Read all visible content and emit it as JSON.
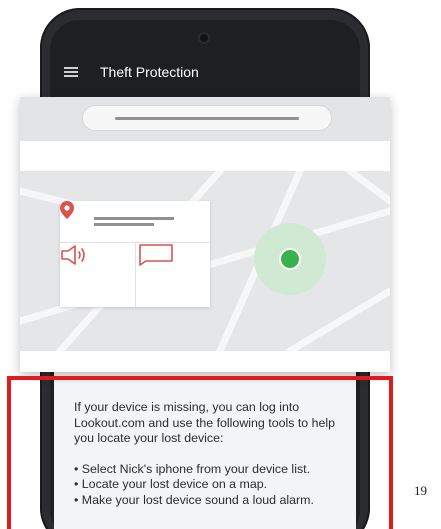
{
  "app": {
    "title": "Theft Protection"
  },
  "icons": {
    "menu": "hamburger-icon",
    "location": "map-pin-icon",
    "alarm": "speaker-icon",
    "message": "message-icon",
    "device": "device-location-dot-icon"
  },
  "colors": {
    "pin": "#d9534f",
    "device_dot": "#37b24d",
    "highlight": "#e01b1b"
  },
  "instructions": {
    "intro": "If your device is missing, you can log into Lookout.com and use the following tools to help you locate your lost device:",
    "bullets": [
      "• Select Nick's iphone from your device list.",
      "• Locate your lost device on a map.",
      "• Make your lost device sound a loud alarm."
    ]
  },
  "page": {
    "number": "19"
  }
}
